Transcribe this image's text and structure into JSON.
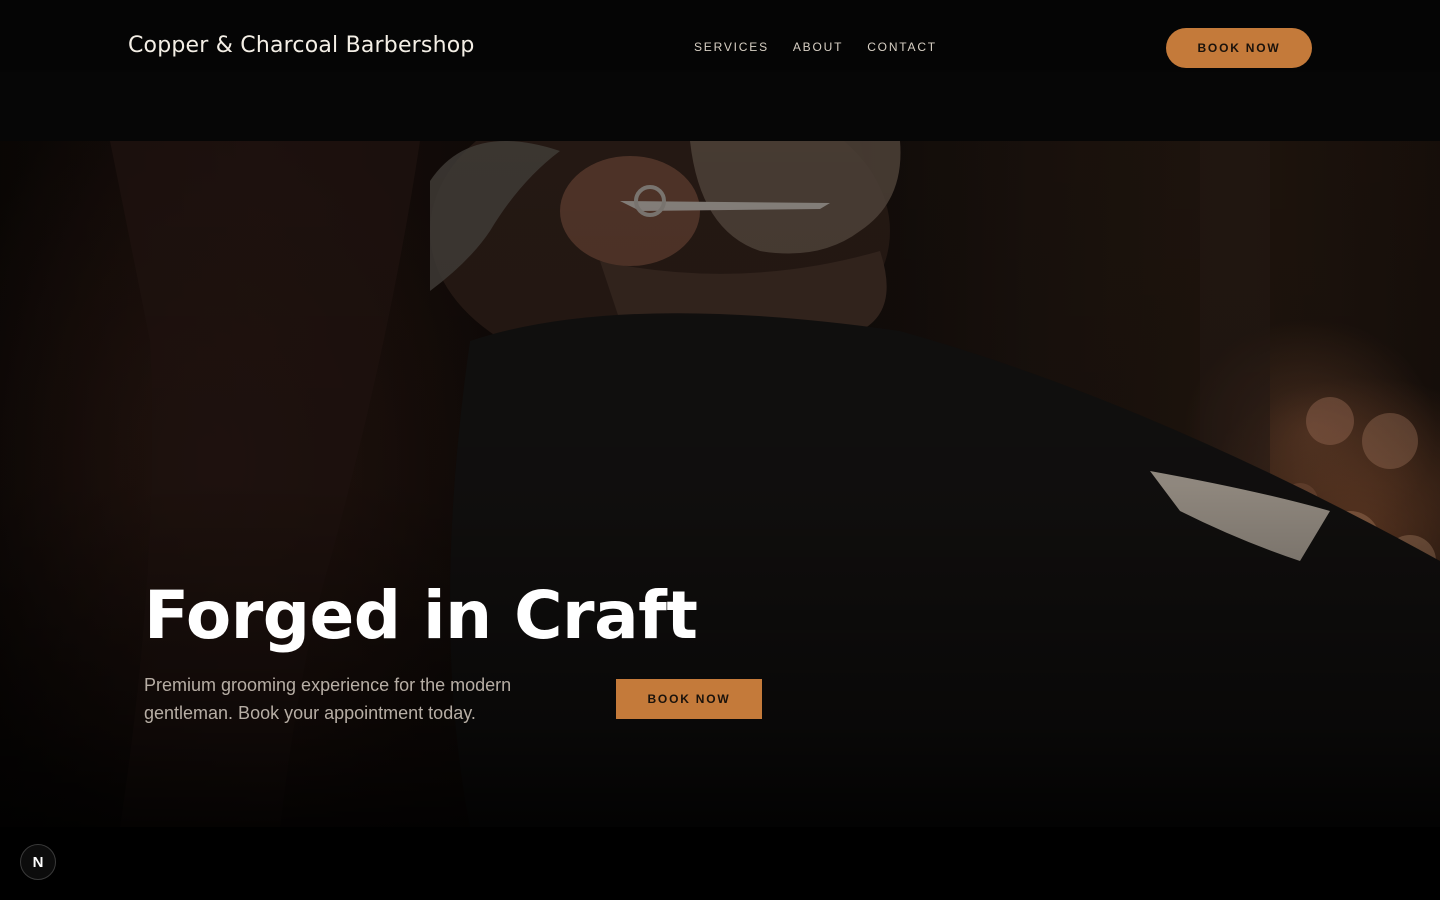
{
  "header": {
    "brand": "Copper & Charcoal Barbershop",
    "nav": [
      "SERVICES",
      "ABOUT",
      "CONTACT"
    ],
    "cta_label": "BOOK NOW"
  },
  "hero": {
    "title": "Forged in Craft",
    "subtitle": "Premium grooming experience for the modern gentleman. Book your appointment today.",
    "cta_label": "BOOK NOW",
    "image_description_icon": "barber-trimming-beard-photo"
  },
  "dev_badge": {
    "letter": "N",
    "icon": "nextjs-icon"
  },
  "colors": {
    "accent": "#c47a3a",
    "background": "#000000",
    "text": "#ffffff"
  }
}
